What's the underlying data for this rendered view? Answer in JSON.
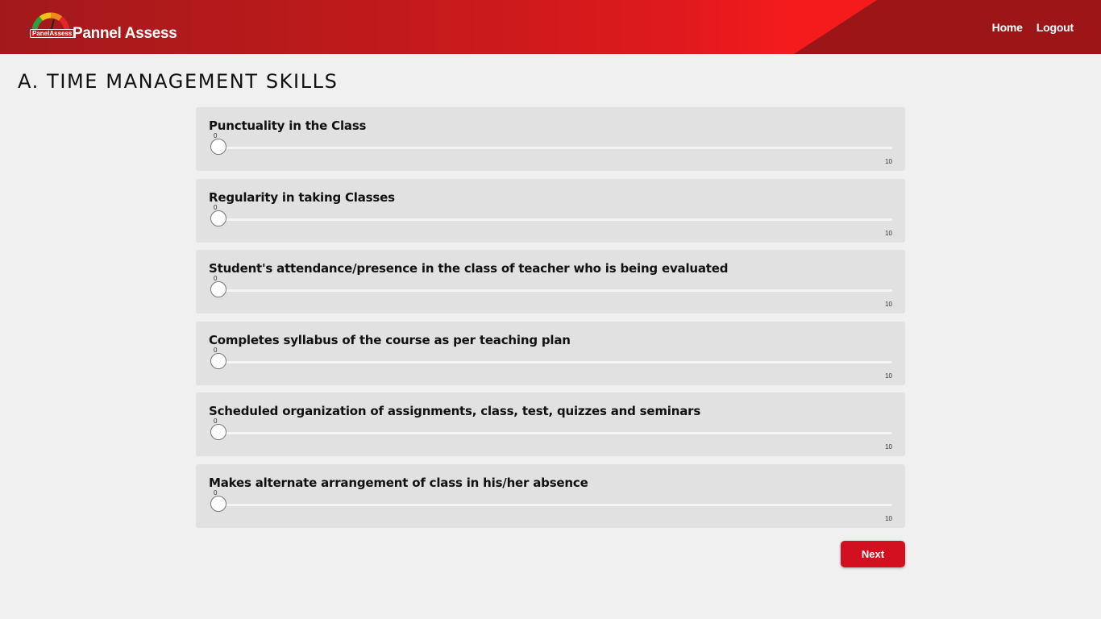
{
  "header": {
    "logo_text": "PanelAssess",
    "brand": "Pannel Assess",
    "nav": [
      {
        "label": "Home"
      },
      {
        "label": "Logout"
      }
    ]
  },
  "section": {
    "title": "A. TIME MANAGEMENT SKILLS"
  },
  "questions": [
    {
      "label": "Punctuality in the Class",
      "value": "0",
      "max": "10"
    },
    {
      "label": "Regularity in taking Classes",
      "value": "0",
      "max": "10"
    },
    {
      "label": "Student's attendance/presence in the class of teacher who is being evaluated",
      "value": "0",
      "max": "10"
    },
    {
      "label": "Completes syllabus of the course as per teaching plan",
      "value": "0",
      "max": "10"
    },
    {
      "label": "Scheduled organization of assignments, class, test, quizzes and seminars",
      "value": "0",
      "max": "10"
    },
    {
      "label": "Makes alternate arrangement of class in his/her absence",
      "value": "0",
      "max": "10"
    }
  ],
  "actions": {
    "next_label": "Next"
  },
  "colors": {
    "header_dark": "#a3191b",
    "header_bright": "#f51b1d",
    "button": "#d31020",
    "card_bg": "#e1e1e1",
    "page_bg": "#f0f0f0"
  }
}
